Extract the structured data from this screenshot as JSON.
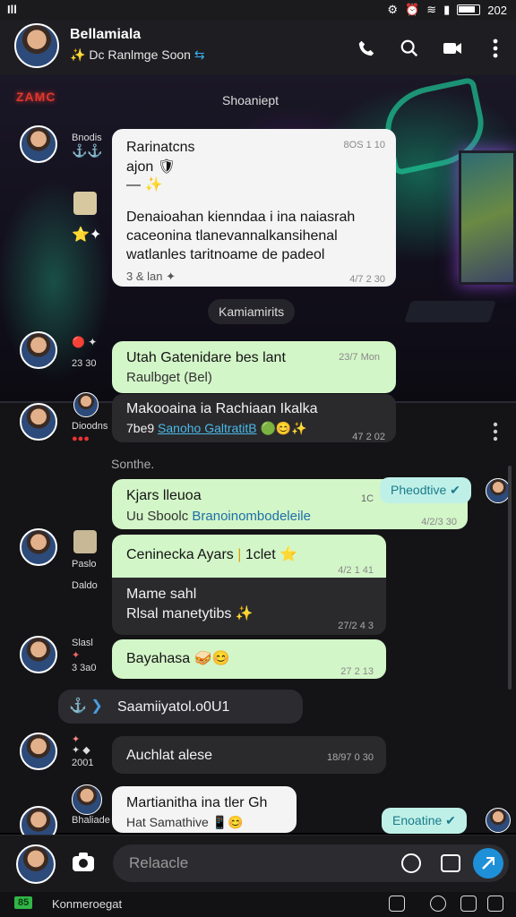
{
  "status": {
    "left": "Ill",
    "time": "202"
  },
  "header": {
    "name": "Bellamiala",
    "subtitle": "Dc Ranlmge Soon"
  },
  "wallpaper": {
    "brand": "ZAMC"
  },
  "pills": {
    "first": "Shoaniept",
    "second": "Kamiamirits",
    "third": "Sonthe."
  },
  "messages": [
    {
      "side": "Bnodis",
      "lines": [
        "Rarinatcns",
        "ajon"
      ],
      "time": "8OS 1 10"
    },
    {
      "text": "Denaioahan kienndaa i ina naiasrah caceonina tlanevannalkansihenal watlanles taritnoame de padeol",
      "meta": "3 & lan",
      "time": "4/7 2 30"
    },
    {
      "side": "23 30",
      "title": "Utah Gatenidare bes lant",
      "sub": "Raulbget (Bel)",
      "time": "23/7 Mon"
    },
    {
      "side": "Dioodns",
      "title": "Makooaina ia Rachiaan Ikalka",
      "sub_prefix": "7be9",
      "sub_link": "Sanoho GaltratitB",
      "time": "47 2 02"
    },
    {
      "title": "Kjars lleuoa",
      "prefix": "Uu Sboolc",
      "link": "Branoinombodeleile",
      "time": "4/2/3 30",
      "tag": "Pheodtive"
    },
    {
      "side": [
        "Paslo",
        "Daldo"
      ],
      "title": "Ceninecka Ayars",
      "suffix": "1clet",
      "time": "4/2 1 41"
    },
    {
      "lines": [
        "Mame sahl",
        "Rlsal manetytibs"
      ],
      "time": "27/2 4 3"
    },
    {
      "side": [
        "Slasl",
        "3 3a0"
      ],
      "title": "Bayahasa",
      "time": "27 2 13"
    },
    {
      "title": "Saamiiyatol.o0U1"
    },
    {
      "side": [
        "2001"
      ],
      "title": "Auchlat alese",
      "time": "18/97 0 30"
    },
    {
      "side": [
        "Bhaliade"
      ],
      "title": "Martianitha ina tler Gh",
      "sub": "Hat Samathive",
      "tag": "Enoatine"
    }
  ],
  "composer": {
    "placeholder": "Relaacle"
  },
  "navbar": {
    "badge": "85",
    "label": "Konmeroegat"
  }
}
